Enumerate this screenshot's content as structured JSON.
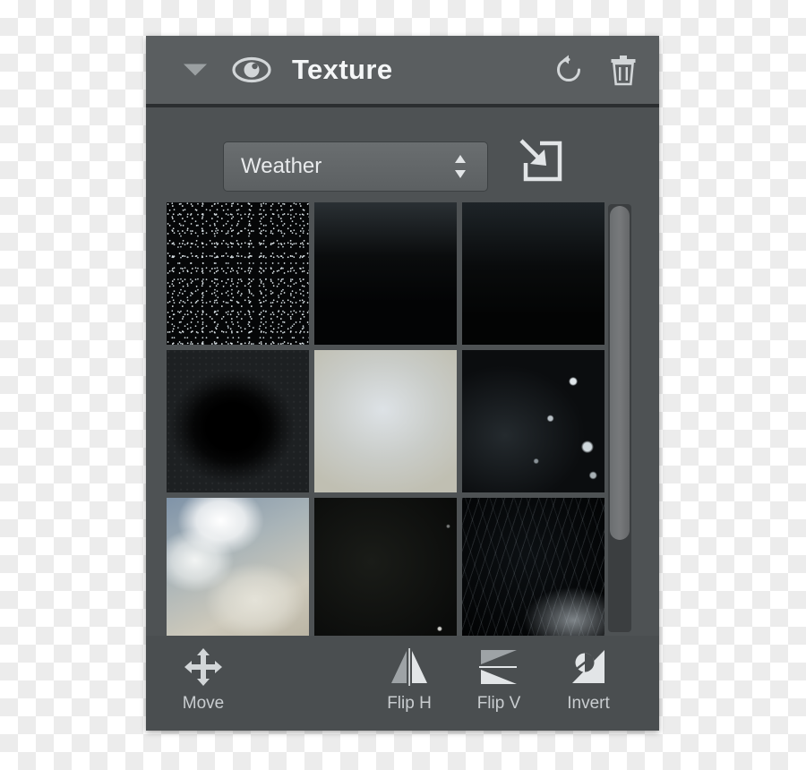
{
  "panel": {
    "title": "Texture",
    "header_icons": [
      {
        "name": "disclosure-triangle",
        "icon": "chevron-down-icon"
      },
      {
        "name": "visibility-toggle",
        "icon": "eye-icon"
      },
      {
        "name": "reset-button",
        "icon": "reset-circular-arrow-icon"
      },
      {
        "name": "delete-button",
        "icon": "trash-icon"
      }
    ]
  },
  "preset": {
    "selected": "Weather",
    "stepper_icon": "up-down-arrows-icon",
    "import_icon": "import-arrow-into-square-icon"
  },
  "grid": {
    "selected_index": 0,
    "selection_color": "#1e9ff2",
    "thumbnails": [
      {
        "name": "texture-thumb-snow-dense",
        "style": "tex-snow-dense"
      },
      {
        "name": "texture-thumb-snow-top",
        "style": "tex-snow-top"
      },
      {
        "name": "texture-thumb-snow-streak",
        "style": "tex-snow-streak"
      },
      {
        "name": "texture-thumb-dark-blob",
        "style": "tex-dark-blob"
      },
      {
        "name": "texture-thumb-light-grain",
        "style": "tex-light-grain"
      },
      {
        "name": "texture-thumb-bokeh",
        "style": "tex-bokeh"
      },
      {
        "name": "texture-thumb-clouds",
        "style": "tex-clouds"
      },
      {
        "name": "texture-thumb-near-black",
        "style": "tex-near-black"
      },
      {
        "name": "texture-thumb-scratch",
        "style": "tex-scratch"
      }
    ],
    "scrollbar": {
      "thumb_percent": 78
    }
  },
  "toolbar": {
    "move_label": "Move",
    "flip_h_label": "Flip H",
    "flip_v_label": "Flip V",
    "invert_label": "Invert"
  },
  "colors": {
    "panel_body": "#4e5254",
    "panel_header": "#5a5e60",
    "toolbar": "#4a4e50",
    "accent_blue": "#1e9ff2",
    "icon_gray": "#d2d6d8"
  }
}
